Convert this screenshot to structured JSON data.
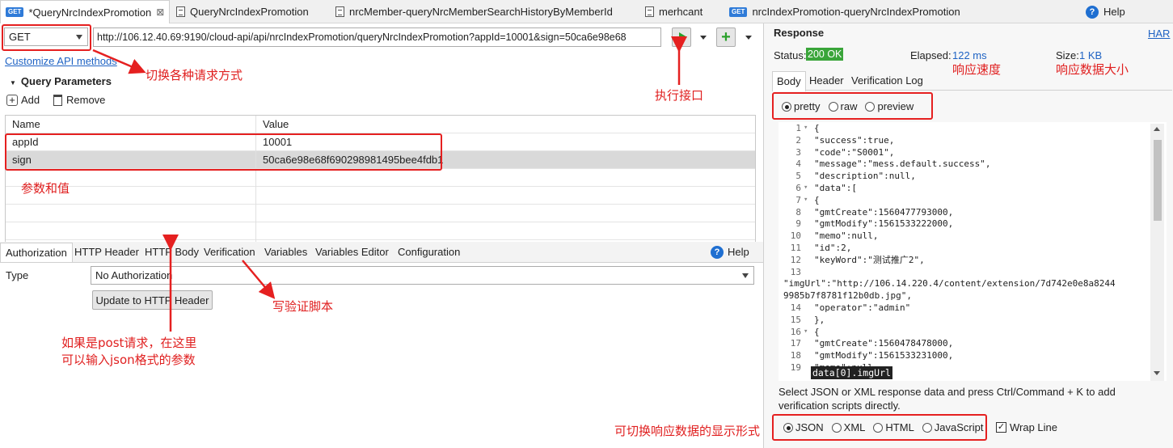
{
  "tabs": [
    {
      "badge": "GET",
      "label": "*QueryNrcIndexPromotion",
      "close": "⊠",
      "icon": "get-badge"
    },
    {
      "label": "QueryNrcIndexPromotion",
      "icon": "document-icon"
    },
    {
      "label": "nrcMember-queryNrcMemberSearchHistoryByMemberId",
      "icon": "document-icon"
    },
    {
      "label": "merhcant",
      "icon": "document-icon"
    },
    {
      "badge": "GET",
      "label": "nrcIndexPromotion-queryNrcIndexPromotion",
      "icon": "get-badge"
    }
  ],
  "help_label": "Help",
  "request": {
    "method": "GET",
    "url": "http://106.12.40.69:9190/cloud-api/api/nrcIndexPromotion/queryNrcIndexPromotion?appId=10001&sign=50ca6e98e68",
    "customize_link": "Customize API methods"
  },
  "query_params": {
    "section_title": "Query Parameters",
    "add_label": "Add",
    "remove_label": "Remove",
    "col_name": "Name",
    "col_value": "Value",
    "rows": [
      {
        "name": "appId",
        "value": "10001"
      },
      {
        "name": "sign",
        "value": "50ca6e98e68f690298981495bee4fdb1"
      }
    ]
  },
  "bottom_tabs": [
    "Authorization",
    "HTTP Header",
    "HTTP Body",
    "Verification",
    "Variables",
    "Variables Editor",
    "Configuration"
  ],
  "auth": {
    "type_label": "Type",
    "type_value": "No Authorization",
    "update_button": "Update to HTTP Header"
  },
  "response": {
    "title": "Response",
    "har_link": "HAR",
    "status_label": "Status:",
    "status_value": "200 OK",
    "elapsed_label": "Elapsed:",
    "elapsed_value": "122 ms",
    "size_label": "Size:",
    "size_value": "1 KB",
    "tabs": [
      "Body",
      "Header",
      "Verification Log"
    ],
    "view_modes": [
      "pretty",
      "raw",
      "preview"
    ],
    "selected_view": "pretty",
    "hint": "Select JSON or XML response data and press Ctrl/Command + K to add verification scripts directly.",
    "formats": [
      "JSON",
      "XML",
      "HTML",
      "JavaScript"
    ],
    "selected_format": "JSON",
    "wrap_line": "Wrap Line",
    "tooltip": "data[0].imgUrl",
    "code_lines": [
      {
        "n": "1",
        "fold": true,
        "t": "{"
      },
      {
        "n": "2",
        "t": "  \"success\":true,"
      },
      {
        "n": "3",
        "t": "  \"code\":\"S0001\","
      },
      {
        "n": "4",
        "t": "  \"message\":\"mess.default.success\","
      },
      {
        "n": "5",
        "t": "  \"description\":null,"
      },
      {
        "n": "6",
        "fold": true,
        "t": "  \"data\":["
      },
      {
        "n": "7",
        "fold": true,
        "t": "    {"
      },
      {
        "n": "8",
        "t": "      \"gmtCreate\":1560477793000,"
      },
      {
        "n": "9",
        "t": "      \"gmtModify\":1561533222000,"
      },
      {
        "n": "10",
        "t": "      \"memo\":null,"
      },
      {
        "n": "11",
        "t": "      \"id\":2,"
      },
      {
        "n": "12",
        "t": "      \"keyWord\":\"测试推广2\","
      },
      {
        "n": "13",
        "t": ""
      },
      {
        "n": "",
        "t": "\"imgUrl\":\"http://106.14.220.4/content/extension/7d742e0e8a8244"
      },
      {
        "n": "",
        "t": "9985b7f8781f12b0db.jpg\","
      },
      {
        "n": "14",
        "t": "      \"operator\":\"admin\""
      },
      {
        "n": "15",
        "t": "    },"
      },
      {
        "n": "16",
        "fold": true,
        "t": "    {"
      },
      {
        "n": "17",
        "t": "      \"gmtCreate\":1560478478000,"
      },
      {
        "n": "18",
        "t": "      \"gmtModify\":1561533231000,"
      },
      {
        "n": "19",
        "t": "      \"memo\":null,"
      }
    ]
  },
  "annotations": {
    "method": "切换各种请求方式",
    "execute": "执行接口",
    "params": "参数和值",
    "verify": "写验证脚本",
    "body_line1": "如果是post请求，在这里",
    "body_line2": "可以输入json格式的参数",
    "speed": "响应速度",
    "size": "响应数据大小",
    "format": "可切换响应数据的显示形式"
  },
  "colors": {
    "accent": "#1f6fd1",
    "status_ok": "#3aa53a",
    "annotation": "#e52020"
  }
}
